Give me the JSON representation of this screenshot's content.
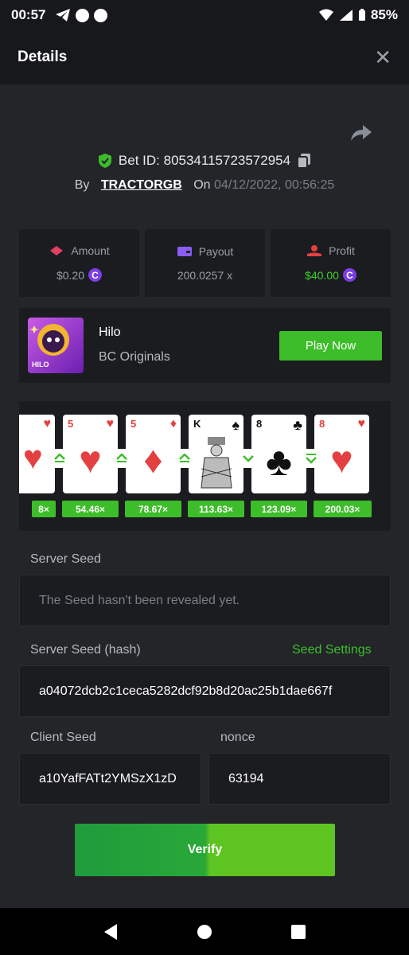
{
  "status_bar": {
    "time": "00:57",
    "battery": "85%"
  },
  "header": {
    "title": "Details",
    "close_label": "✕"
  },
  "bet": {
    "id_label": "Bet ID: 80534115723572954",
    "by_label": "By",
    "user": "TRACTORGB",
    "on_label": "On",
    "date": "04/12/2022, 00:56:25"
  },
  "stats": {
    "amount": {
      "label": "Amount",
      "value": "$0.20"
    },
    "payout": {
      "label": "Payout",
      "value": "200.0257 x"
    },
    "profit": {
      "label": "Profit",
      "value": "$40.00"
    }
  },
  "game": {
    "name": "Hilo",
    "provider": "BC Originals",
    "play_label": "Play Now",
    "thumb_label": "HILO"
  },
  "cards": [
    {
      "rank": "",
      "suit": "♥",
      "color": "red"
    },
    {
      "rank": "5",
      "suit": "♥",
      "color": "red"
    },
    {
      "rank": "5",
      "suit": "♦",
      "color": "red"
    },
    {
      "rank": "K",
      "suit": "♠",
      "color": "black"
    },
    {
      "rank": "8",
      "suit": "♣",
      "color": "black"
    },
    {
      "rank": "8",
      "suit": "♥",
      "color": "red"
    }
  ],
  "arrows": [
    "up",
    "up",
    "up",
    "down",
    "down-equal"
  ],
  "multipliers": [
    "8×",
    "54.46×",
    "78.67×",
    "113.63×",
    "123.09×",
    "200.03×"
  ],
  "server_seed": {
    "label": "Server Seed",
    "value": "The Seed hasn't been revealed yet."
  },
  "server_seed_hash": {
    "label": "Server Seed (hash)",
    "settings_label": "Seed Settings",
    "value": "a04072dcb2c1ceca5282dcf92b8d20ac25b1dae667f"
  },
  "client_seed": {
    "label": "Client Seed",
    "value": "a10YafFATt2YMSzX1zD"
  },
  "nonce": {
    "label": "nonce",
    "value": "63194"
  },
  "verify_label": "Verify",
  "colors": {
    "accent_green": "#3dbd2a",
    "coin_purple": "#7b3fe4",
    "background": "#232529"
  }
}
